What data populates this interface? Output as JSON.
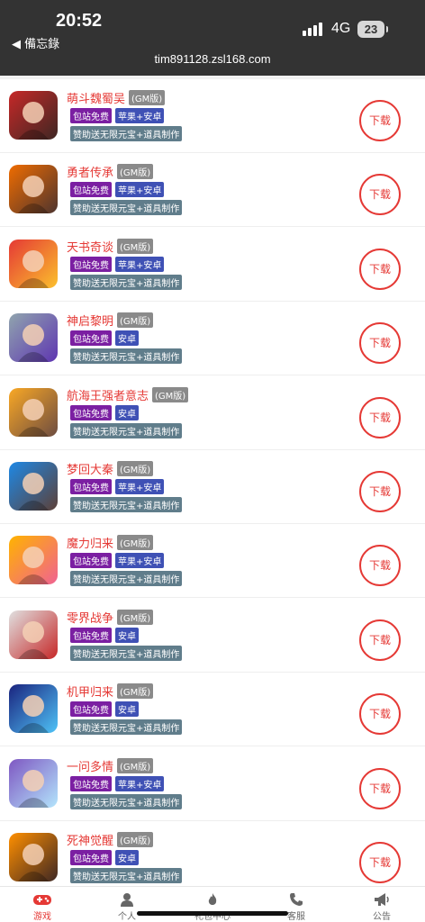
{
  "status_bar": {
    "time": "20:52",
    "back_label": "◀ 備忘錄",
    "network": "4G",
    "battery": "23",
    "url": "tim891128.zsl168.com"
  },
  "games": [
    {
      "title": "萌斗魏蜀吴",
      "gm": "(GM版)",
      "tag_free": "包站免费",
      "tag_platform": "苹果+安卓",
      "tag_sponsor": "赞助送无限元宝+道具制作",
      "download": "下载",
      "icon_colors": [
        "#c62828",
        "#3e2723"
      ]
    },
    {
      "title": "勇者传承",
      "gm": "(GM版)",
      "tag_free": "包站免费",
      "tag_platform": "苹果+安卓",
      "tag_sponsor": "赞助送无限元宝+道具制作",
      "download": "下载",
      "icon_colors": [
        "#ef6c00",
        "#4e342e"
      ]
    },
    {
      "title": "天书奇谈",
      "gm": "(GM版)",
      "tag_free": "包站免费",
      "tag_platform": "苹果+安卓",
      "tag_sponsor": "赞助送无限元宝+道具制作",
      "download": "下载",
      "icon_colors": [
        "#e53935",
        "#fbc02d"
      ]
    },
    {
      "title": "神启黎明",
      "gm": "(GM版)",
      "tag_free": "包站免费",
      "tag_platform": "安卓",
      "tag_sponsor": "赞助送无限元宝+道具制作",
      "download": "下载",
      "icon_colors": [
        "#90a4ae",
        "#5e35b1"
      ]
    },
    {
      "title": "航海王强者意志",
      "gm": "(GM版)",
      "tag_free": "包站免费",
      "tag_platform": "安卓",
      "tag_sponsor": "赞助送无限元宝+道具制作",
      "download": "下载",
      "icon_colors": [
        "#f9a825",
        "#6d4c41"
      ]
    },
    {
      "title": "梦回大秦",
      "gm": "(GM版)",
      "tag_free": "包站免费",
      "tag_platform": "苹果+安卓",
      "tag_sponsor": "赞助送无限元宝+道具制作",
      "download": "下载",
      "icon_colors": [
        "#1e88e5",
        "#5d4037"
      ]
    },
    {
      "title": "魔力归来",
      "gm": "(GM版)",
      "tag_free": "包站免费",
      "tag_platform": "苹果+安卓",
      "tag_sponsor": "赞助送无限元宝+道具制作",
      "download": "下载",
      "icon_colors": [
        "#ffb300",
        "#f06292"
      ]
    },
    {
      "title": "零界战争",
      "gm": "(GM版)",
      "tag_free": "包站免费",
      "tag_platform": "安卓",
      "tag_sponsor": "赞助送无限元宝+道具制作",
      "download": "下载",
      "icon_colors": [
        "#e0e0e0",
        "#c62828"
      ]
    },
    {
      "title": "机甲归来",
      "gm": "(GM版)",
      "tag_free": "包站免费",
      "tag_platform": "安卓",
      "tag_sponsor": "赞助送无限元宝+道具制作",
      "download": "下载",
      "icon_colors": [
        "#1a237e",
        "#4fc3f7"
      ]
    },
    {
      "title": "一问多情",
      "gm": "(GM版)",
      "tag_free": "包站免费",
      "tag_platform": "苹果+安卓",
      "tag_sponsor": "赞助送无限元宝+道具制作",
      "download": "下载",
      "icon_colors": [
        "#7e57c2",
        "#b3e5fc"
      ]
    },
    {
      "title": "死神觉醒",
      "gm": "(GM版)",
      "tag_free": "包站免费",
      "tag_platform": "安卓",
      "tag_sponsor": "赞助送无限元宝+道具制作",
      "download": "下载",
      "icon_colors": [
        "#ff8f00",
        "#3e2723"
      ]
    }
  ],
  "tabbar": {
    "games": "游戏",
    "profile": "个人",
    "gift": "礼包中心",
    "service": "客服",
    "notice": "公告"
  },
  "colors": {
    "accent": "#e53935",
    "status_bg": "#333333"
  }
}
